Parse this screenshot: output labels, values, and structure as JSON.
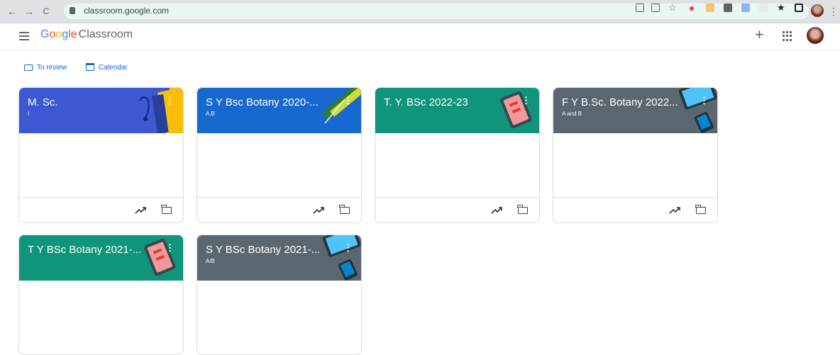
{
  "browser": {
    "url": "classroom.google.com",
    "back_icon": "←",
    "forward_icon": "→",
    "reload_icon": "C"
  },
  "header": {
    "logo_google": [
      "G",
      "o",
      "o",
      "g",
      "l",
      "e"
    ],
    "logo_classroom": "Classroom",
    "plus_label": "+"
  },
  "subbar": {
    "to_review": "To review",
    "calendar": "Calendar"
  },
  "classes": [
    {
      "title": "M. Sc.",
      "section": "I",
      "color": "#3c58d2"
    },
    {
      "title": "S Y Bsc Botany 2020-...",
      "section": "A,B",
      "color": "#1769cf"
    },
    {
      "title": "T. Y. BSc 2022-23",
      "section": "",
      "color": "#10957c"
    },
    {
      "title": "F Y B.Sc. Botany 2022...",
      "section": "A and B",
      "color": "#5b6770"
    },
    {
      "title": "T Y BSc Botany 2021-...",
      "section": "",
      "color": "#10957c"
    },
    {
      "title": "S Y BSc Botany 2021-...",
      "section": "A/B",
      "color": "#5b6770"
    }
  ]
}
